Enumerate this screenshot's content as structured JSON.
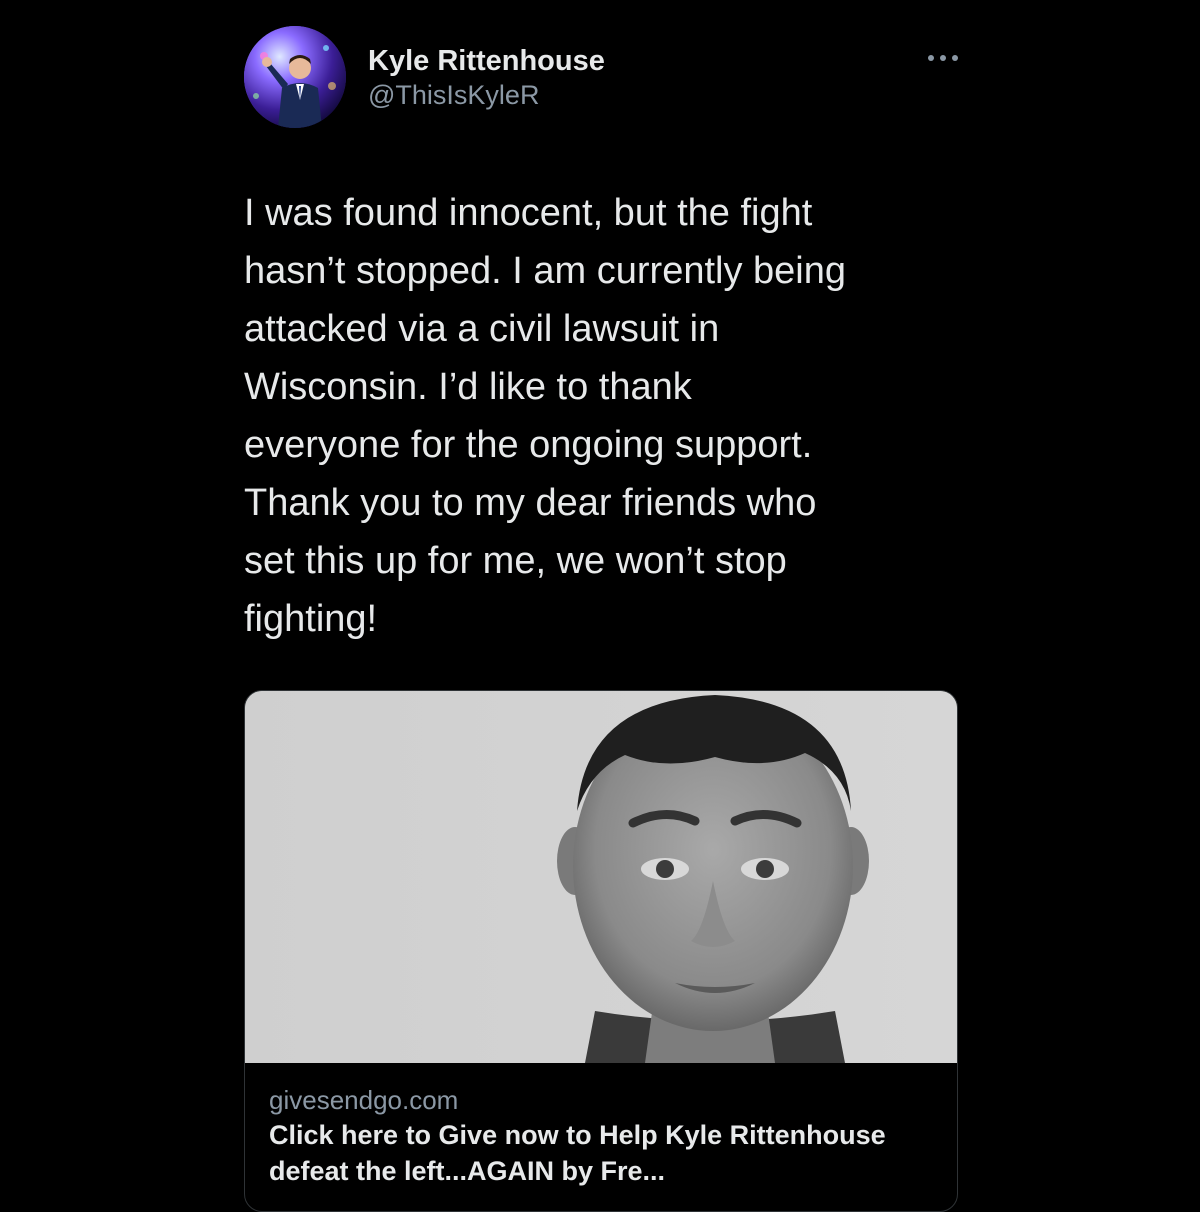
{
  "author": {
    "display_name": "Kyle Rittenhouse",
    "handle": "@ThisIsKyleR"
  },
  "icons": {
    "more": "more-horizontal-icon",
    "avatar": "profile-avatar"
  },
  "tweet": {
    "text": "I was found innocent, but the fight\nhasn’t stopped. I am currently being\nattacked via a civil lawsuit in\nWisconsin. I’d like to thank\neveryone for the ongoing support.\nThank you to my dear friends who\nset this up for me, we won’t stop\nfighting!"
  },
  "link_card": {
    "domain": "givesendgo.com",
    "title": "Click here to Give now to Help Kyle Rittenhouse defeat the left...AGAIN by Fre..."
  },
  "colors": {
    "background": "#000000",
    "text_primary": "#e7e9ea",
    "text_secondary": "#8b98a5",
    "card_border": "#2f3336"
  }
}
